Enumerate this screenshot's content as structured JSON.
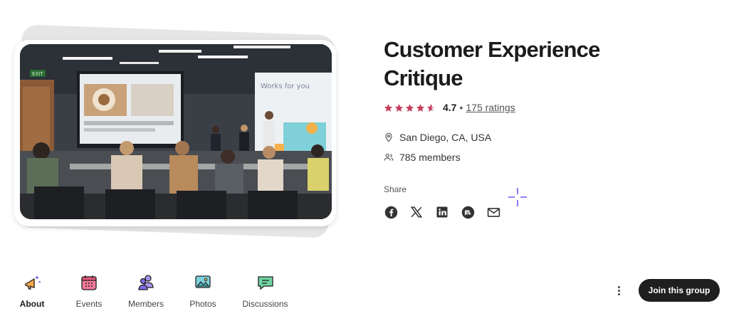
{
  "group": {
    "title": "Customer Experience Critique",
    "rating": "4.7",
    "rating_fraction": 0.94,
    "rating_separator": "•",
    "ratings_count": "175 ratings",
    "location": "San Diego, CA, USA",
    "members": "785 members"
  },
  "photo": {
    "screen_text": "EXIT",
    "wall_text": "Works for you"
  },
  "share": {
    "label": "Share",
    "icons": [
      "facebook-icon",
      "x-icon",
      "linkedin-icon",
      "meetup-icon",
      "mail-icon"
    ]
  },
  "nav": {
    "items": [
      {
        "label": "About",
        "icon": "megaphone-icon",
        "active": true
      },
      {
        "label": "Events",
        "icon": "calendar-icon",
        "active": false
      },
      {
        "label": "Members",
        "icon": "people-icon",
        "active": false
      },
      {
        "label": "Photos",
        "icon": "photo-icon",
        "active": false
      },
      {
        "label": "Discussions",
        "icon": "chat-icon",
        "active": false
      }
    ]
  },
  "actions": {
    "join_label": "Join this group"
  },
  "colors": {
    "star": "#c63d5d",
    "button": "#1f1f1f",
    "sparkle": "#6b5cf6"
  }
}
